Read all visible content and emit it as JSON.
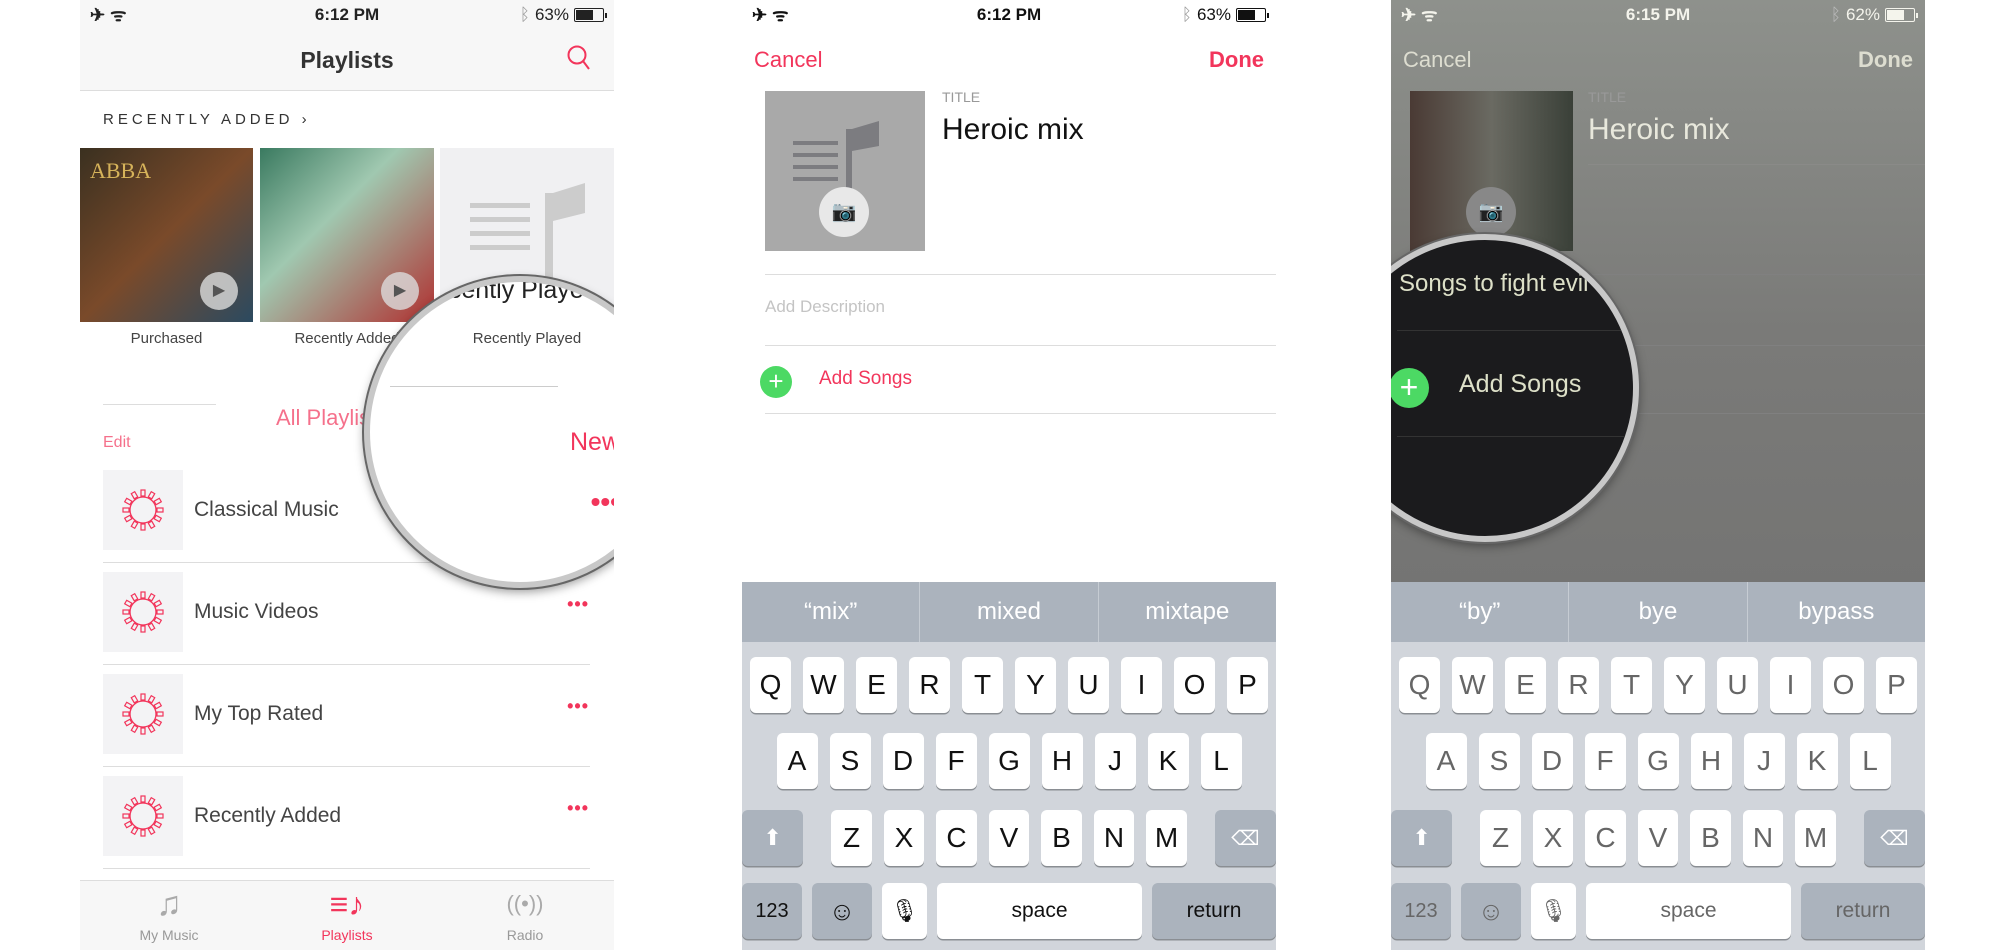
{
  "colors": {
    "accent": "#f2355b",
    "green": "#4cd964"
  },
  "panel1": {
    "status": {
      "time": "6:12 PM",
      "battery": "63%",
      "battery_level": 0.63
    },
    "title": "Playlists",
    "recently_added": "RECENTLY ADDED",
    "albums": [
      {
        "label": "Purchased"
      },
      {
        "label": "Recently Added"
      },
      {
        "label": "Recently Played"
      }
    ],
    "all_playlists": "All Playlists",
    "edit": "Edit",
    "new": "New",
    "magnified_text": "ecently Playe",
    "rows": [
      {
        "title": "Classical Music"
      },
      {
        "title": "Music Videos"
      },
      {
        "title": "My Top Rated"
      },
      {
        "title": "Recently Added"
      }
    ],
    "tabs": [
      {
        "label": "My Music",
        "icon": "music-note-icon"
      },
      {
        "label": "Playlists",
        "icon": "playlist-icon",
        "active": true
      },
      {
        "label": "Radio",
        "icon": "radio-icon"
      }
    ]
  },
  "panel2": {
    "status": {
      "time": "6:12 PM",
      "battery": "63%",
      "battery_level": 0.63
    },
    "cancel": "Cancel",
    "done": "Done",
    "title_label": "TITLE",
    "title_value": "Heroic mix",
    "description_placeholder": "Add Description",
    "add_songs": "Add Songs",
    "suggestions": [
      "“mix”",
      "mixed",
      "mixtape"
    ]
  },
  "panel3": {
    "status": {
      "time": "6:15 PM",
      "battery": "62%",
      "battery_level": 0.62
    },
    "cancel": "Cancel",
    "done": "Done",
    "title_label": "TITLE",
    "title_value": "Heroic mix",
    "description_value": "Songs to fight evil",
    "add_songs": "Add Songs",
    "suggestions": [
      "“by”",
      "bye",
      "bypass"
    ]
  },
  "keyboard": {
    "rows": [
      [
        "Q",
        "W",
        "E",
        "R",
        "T",
        "Y",
        "U",
        "I",
        "O",
        "P"
      ],
      [
        "A",
        "S",
        "D",
        "F",
        "G",
        "H",
        "J",
        "K",
        "L"
      ],
      [
        "Z",
        "X",
        "C",
        "V",
        "B",
        "N",
        "M"
      ]
    ],
    "numbers": "123",
    "space": "space",
    "return": "return"
  }
}
